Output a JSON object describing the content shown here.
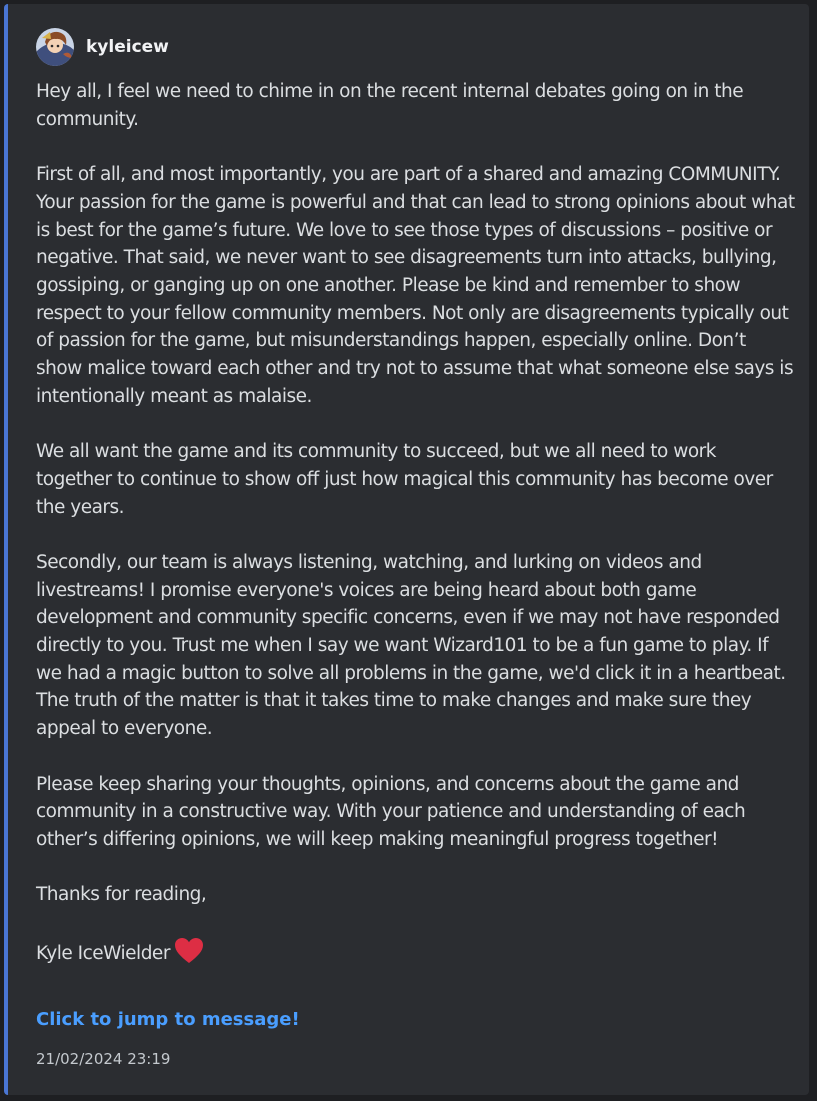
{
  "author": {
    "name": "kyleicew",
    "avatar_icon": "wizard-avatar"
  },
  "message": {
    "paragraphs": [
      "Hey all, I feel we need to chime in on the recent internal debates going on in the community.",
      "First of all, and most importantly, you are part of a shared and amazing COMMUNITY. Your passion for the game is powerful and that can lead to strong opinions about what is best for the game’s future. We love to see those types of discussions – positive or negative. That said, we never want to see disagreements turn into attacks, bullying, gossiping, or ganging up on one another. Please be kind and remember to show respect to your fellow community members. Not only are disagreements typically out of passion for the game, but misunderstandings happen, especially online. Don’t show malice toward each other and try not to assume that what someone else says is intentionally meant as malaise.",
      "We all want the game and its community to succeed, but we all need to work together to continue to show off just how magical this community has become over the years.",
      "Secondly, our team is always listening, watching, and lurking on videos and livestreams! I promise everyone's voices are being heard about both game development and community specific concerns, even if we may not have responded directly to you. Trust me when I say we want Wizard101 to be a fun game to play. If we had a magic button to solve all problems in the game, we'd click it in a heartbeat. The truth of the matter is that it takes time to make changes and make sure they appeal to everyone.",
      "Please keep sharing your thoughts, opinions, and concerns about the game and community in a constructive way. With your patience and understanding of each other’s differing opinions, we will keep making meaningful progress together!",
      "Thanks for reading,"
    ],
    "signature": "Kyle IceWielder",
    "signature_emoji": "red-heart-icon"
  },
  "jump_link": "Click to jump to message!",
  "timestamp": "21/02/2024 23:19",
  "colors": {
    "background": "#2b2d31",
    "accent_bar": "#4a76d4",
    "link": "#4a9eff",
    "text": "#dbdee1",
    "heart": "#e03e4e"
  }
}
